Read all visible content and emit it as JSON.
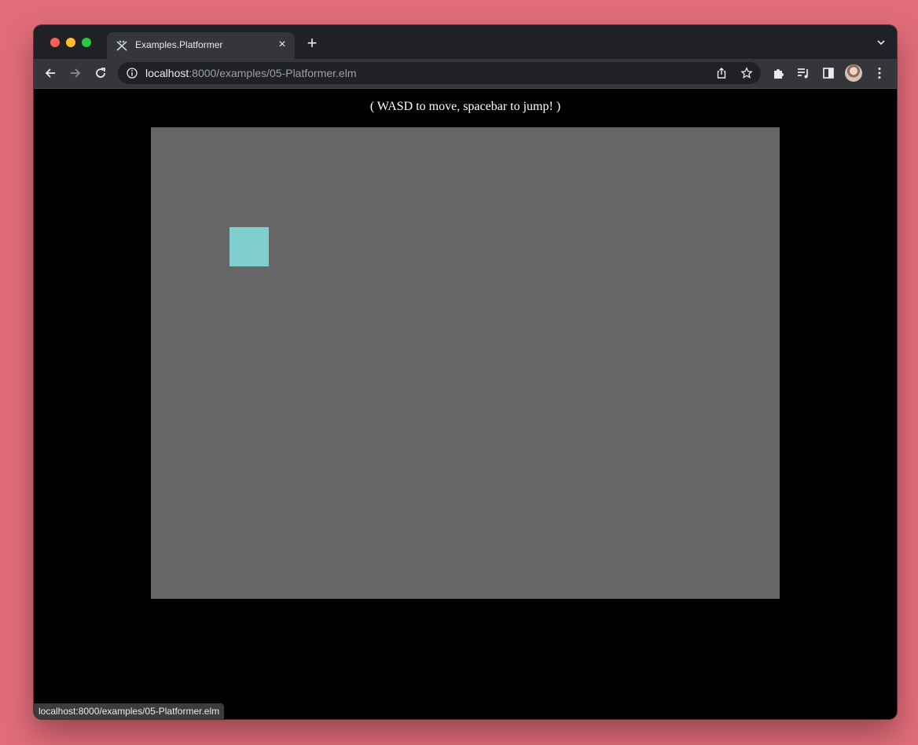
{
  "browser": {
    "tab": {
      "title": "Examples.Platformer"
    },
    "address": {
      "host": "localhost",
      "rest": ":8000/examples/05-Platformer.elm"
    },
    "status_url": "localhost:8000/examples/05-Platformer.elm",
    "icons": [
      "back-icon",
      "forward-icon",
      "reload-icon",
      "info-icon",
      "share-icon",
      "star-icon",
      "extensions-icon",
      "media-icon",
      "side-panel-icon",
      "kebab-menu-icon"
    ]
  },
  "page": {
    "instructions": "( WASD to move, spacebar to jump! )",
    "game": {
      "background": "#666666",
      "player_color": "#7fcdcd"
    }
  }
}
